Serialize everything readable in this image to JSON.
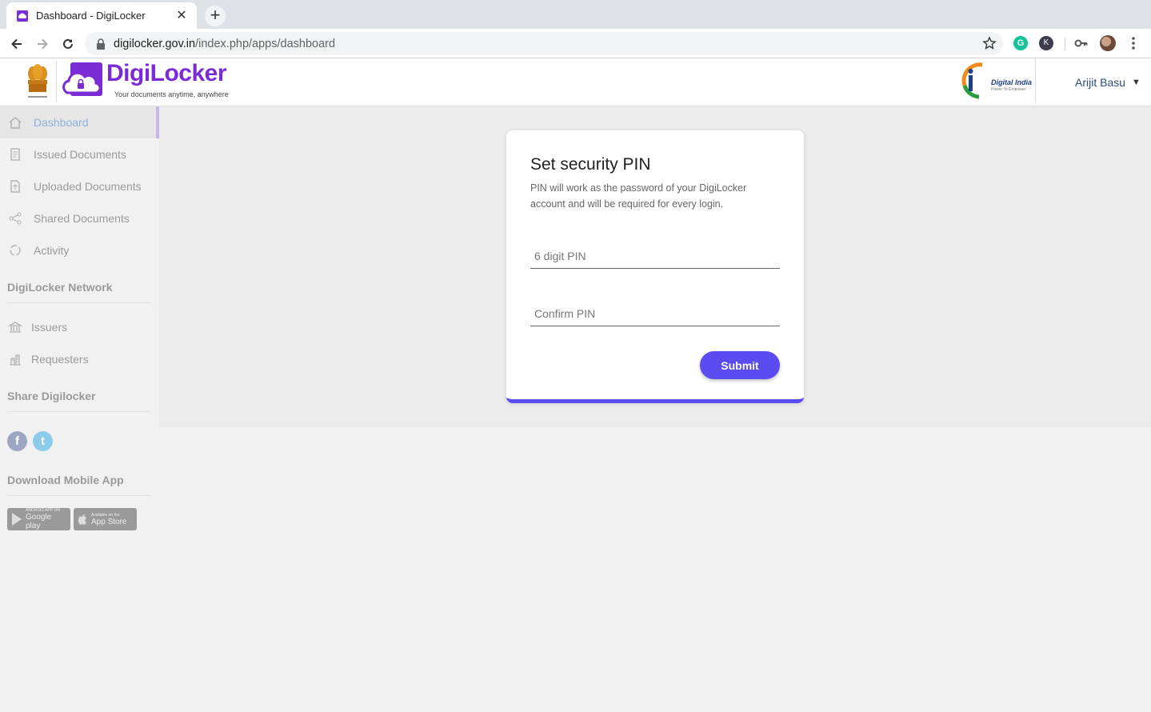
{
  "browser": {
    "tab_title": "Dashboard - DigiLocker",
    "tab_close": "✕",
    "new_tab": "+",
    "url_host": "digilocker.gov.in",
    "url_path": "/index.php/apps/dashboard",
    "extensions": {
      "grammarly": "G",
      "k": "K"
    }
  },
  "header": {
    "logo_text": "DigiLocker",
    "logo_tagline": "Your documents anytime, anywhere",
    "digital_india_title": "Digital India",
    "digital_india_tagline": "Power To Empower",
    "user_name": "Arijit Basu",
    "user_caret": "▼"
  },
  "sidebar": {
    "items": [
      {
        "label": "Dashboard",
        "icon": "home-icon",
        "active": true
      },
      {
        "label": "Issued Documents",
        "icon": "document-icon"
      },
      {
        "label": "Uploaded Documents",
        "icon": "upload-icon"
      },
      {
        "label": "Shared Documents",
        "icon": "share-icon"
      },
      {
        "label": "Activity",
        "icon": "activity-icon"
      }
    ],
    "network_heading": "DigiLocker Network",
    "network_items": [
      {
        "label": "Issuers",
        "icon": "bank-icon"
      },
      {
        "label": "Requesters",
        "icon": "building-icon"
      }
    ],
    "share_heading": "Share Digilocker",
    "social": {
      "facebook": "f",
      "twitter": "t"
    },
    "download_heading": "Download Mobile App",
    "google_play_small": "ANDROID APP ON",
    "google_play_big": "Google play",
    "app_store_small": "Available on the",
    "app_store_big": "App Store"
  },
  "pin_card": {
    "title": "Set security PIN",
    "description": "PIN will work as the password of your DigiLocker account and will be required for every login.",
    "pin_placeholder": "6 digit PIN",
    "confirm_placeholder": "Confirm PIN",
    "submit_label": "Submit"
  },
  "colors": {
    "brand_purple": "#7b2bd6",
    "primary_button": "#5b4cf2",
    "active_nav_text": "#8fb2dc"
  }
}
